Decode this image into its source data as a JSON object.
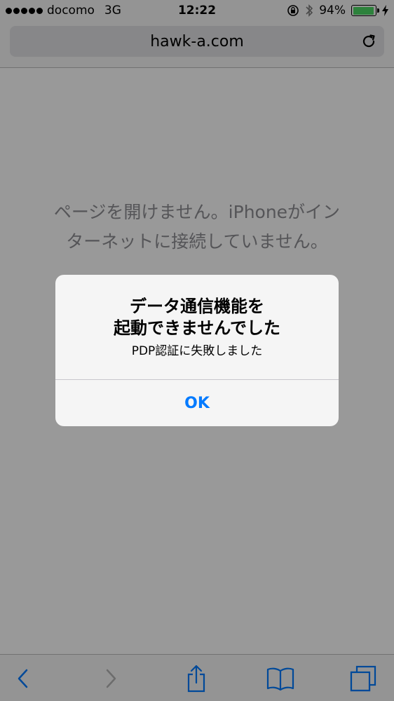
{
  "status_bar": {
    "carrier": "docomo",
    "network": "3G",
    "time": "12:22",
    "battery_percent": "94%",
    "battery_level": 0.94,
    "icons": [
      "signal-dots",
      "rotation-lock-icon",
      "bluetooth-icon",
      "battery-icon",
      "charging-bolt-icon"
    ]
  },
  "url_bar": {
    "url": "hawk-a.com",
    "reload_icon": "reload-icon"
  },
  "page": {
    "message_line1": "ページを開けません。iPhoneがイン",
    "message_line2": "ターネットに接続していません。"
  },
  "alert": {
    "title_line1": "データ通信機能を",
    "title_line2": "起動できませんでした",
    "message": "PDP認証に失敗しました",
    "ok_label": "OK"
  },
  "toolbar": {
    "icons": [
      "back-icon",
      "forward-icon",
      "share-icon",
      "bookmarks-icon",
      "tabs-icon"
    ]
  },
  "colors": {
    "accent": "#007aff",
    "battery_fill": "#4cd964",
    "secondary_text": "#8e8e93"
  }
}
